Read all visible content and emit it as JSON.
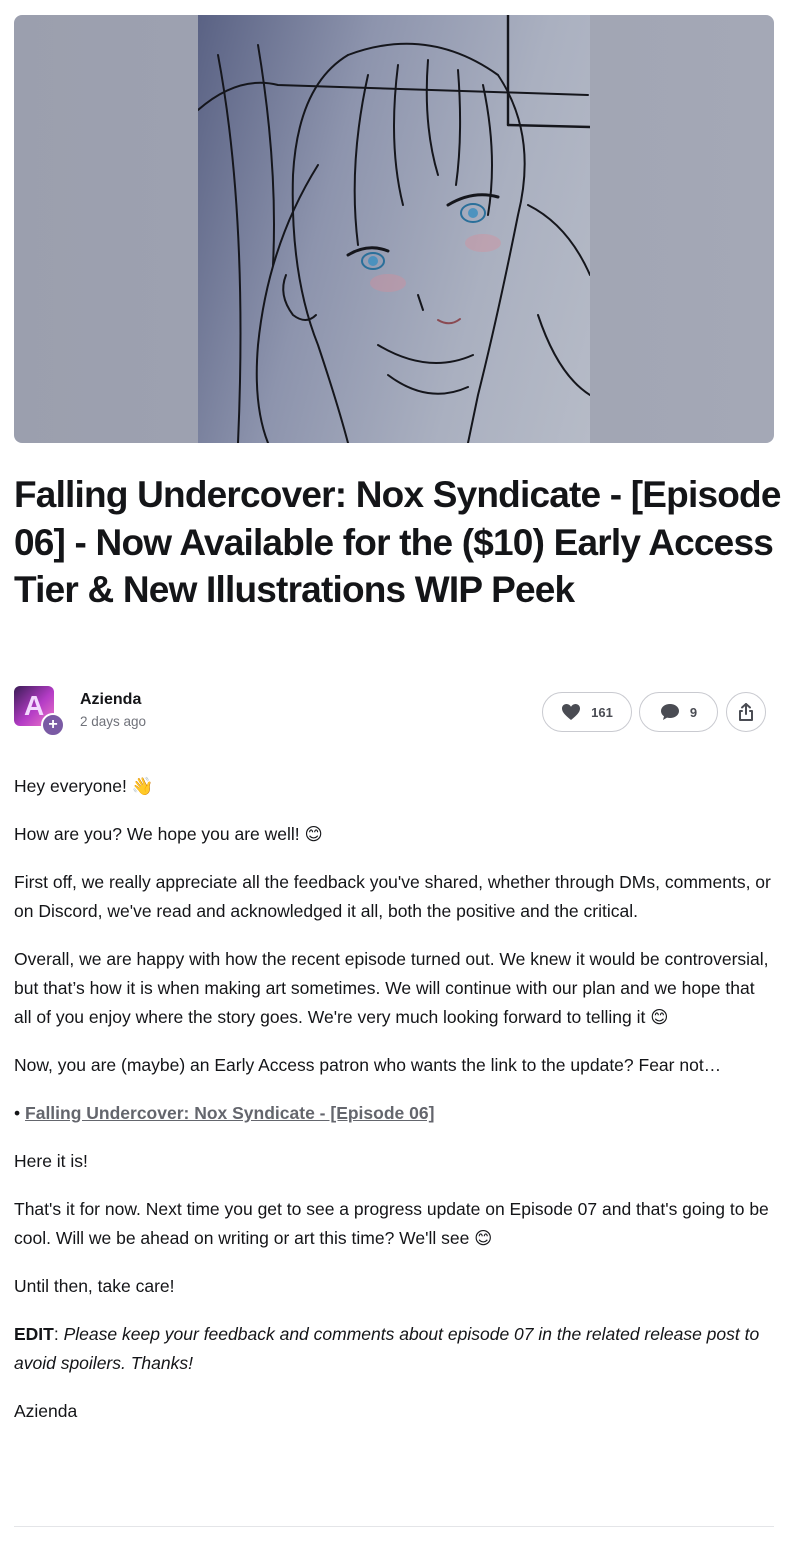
{
  "post": {
    "title": "Falling Undercover: Nox Syndicate - [Episode 06] - Now Available for the ($10) Early Access Tier & New Illustrations WIP Peek"
  },
  "author": {
    "name": "Azienda",
    "time": "2 days ago",
    "avatar_letter": "A"
  },
  "actions": {
    "likes": "161",
    "comments": "9"
  },
  "body": {
    "p1": "Hey everyone! 👋",
    "p2": "How are you? We hope you are well! 😊",
    "p3": "First off, we really appreciate all the feedback you've shared, whether through DMs, comments, or on Discord, we've read and acknowledged it all, both the positive and the critical.",
    "p4": "Overall, we are happy with how the recent episode turned out. We knew it would be controversial, but that’s how it is when making art sometimes. We will continue with our plan and we hope that all of you enjoy where the story goes. We're very much looking forward to telling it 😊",
    "p5": "Now, you are (maybe) an Early Access patron who wants the link to the update? Fear not…",
    "bullet": "•",
    "link": "Falling Undercover: Nox Syndicate - [Episode 06]",
    "p6": "Here it is!",
    "p7": "That's it for now. Next time you get to see a progress update on Episode 07 and that's going to be cool. Will we be ahead on writing or art this time? We'll see 😊",
    "p8": "Until then, take care!",
    "edit_label": "EDIT",
    "edit_colon": ": ",
    "edit_text": "Please keep your feedback and comments about episode 07 in the related release post to avoid spoilers. Thanks!",
    "signoff": "Azienda"
  },
  "icons": {
    "like": "heart-icon",
    "comment": "speech-bubble-icon",
    "share": "share-icon",
    "follow": "plus-icon"
  },
  "colors": {
    "text": "#141518",
    "muted": "#70727a",
    "link": "#64666d",
    "avatar_badge": "#7a5aa4"
  }
}
